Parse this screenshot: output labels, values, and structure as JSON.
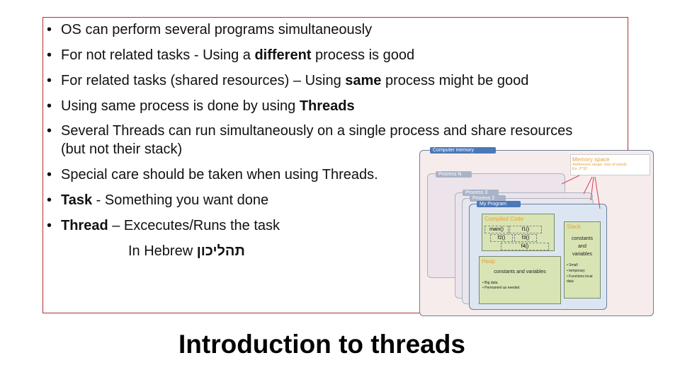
{
  "bullets": [
    {
      "parts": [
        {
          "text": "OS can perform several programs simultaneously",
          "bold": false
        }
      ]
    },
    {
      "parts": [
        {
          "text": "For not related tasks - Using a ",
          "bold": false
        },
        {
          "text": "different",
          "bold": true
        },
        {
          "text": " process is good",
          "bold": false
        }
      ]
    },
    {
      "parts": [
        {
          "text": "For related tasks (shared resources) – Using ",
          "bold": false
        },
        {
          "text": "same",
          "bold": true
        },
        {
          "text": " process might be good",
          "bold": false
        }
      ]
    },
    {
      "parts": [
        {
          "text": "Using same process is done by using ",
          "bold": false
        },
        {
          "text": "Threads",
          "bold": true
        }
      ]
    },
    {
      "parts": [
        {
          "text": "Several Threads can run simultaneously on a single process and share resources",
          "bold": false
        }
      ],
      "cont": "(but not their stack)"
    },
    {
      "parts": [
        {
          "text": "Special care should be taken when using Threads.",
          "bold": false
        }
      ]
    },
    {
      "parts": [
        {
          "text": "Task",
          "bold": true
        },
        {
          "text": " - Something you want done",
          "bold": false
        }
      ]
    },
    {
      "parts": [
        {
          "text": "Thread",
          "bold": true
        },
        {
          "text": " – Excecutes/Runs the task",
          "bold": false
        }
      ]
    }
  ],
  "hebrew_prefix": "In Hebrew",
  "hebrew_word": "תהליכון",
  "title": "Introduction to threads",
  "diagram": {
    "computer_memory": "Computer memory",
    "memory_space": {
      "title": "Memory space",
      "line1": "Addresses range: size of words",
      "line2": "Ex: 2^32"
    },
    "process_n": "Process N",
    "process_3": "Process 3",
    "process_2": "Process 2",
    "my_program": "My Program",
    "compiled_code": "Compiled Code",
    "functions": [
      "main()",
      "f1()",
      "f2()",
      "f3()",
      "f4()"
    ],
    "heap": {
      "title": "Heap",
      "text": "constants and variables",
      "items": [
        "Big data",
        "Permanent  as needed"
      ]
    },
    "stack": {
      "title": "Stack",
      "text": "constants and variables",
      "items": [
        "Small",
        "temporary",
        "Functions local data"
      ]
    }
  },
  "colors": {
    "frame": "#aa3333",
    "label_blue": "#4a78b8",
    "accent_orange": "#e8a03a"
  }
}
